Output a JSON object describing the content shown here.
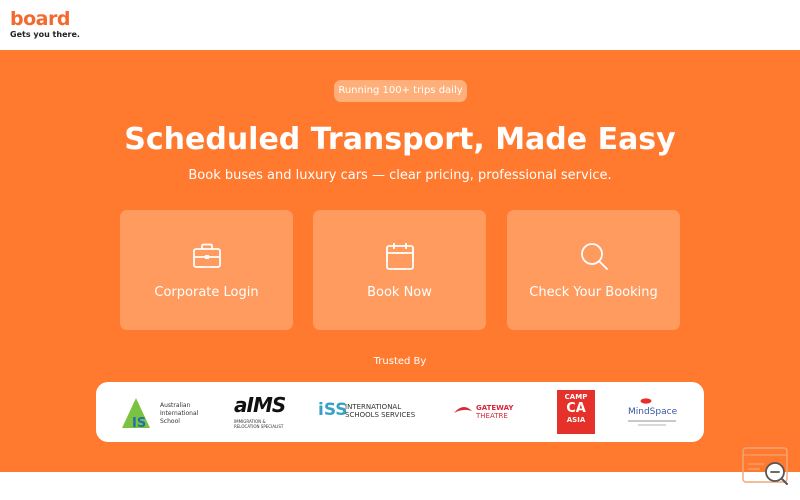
{
  "header": {
    "logo_word": "board",
    "logo_tagline": "Gets you there."
  },
  "hero": {
    "badge": "Running 100+ trips daily",
    "title": "Scheduled Transport, Made Easy",
    "subtitle": "Book buses and luxury cars — clear pricing, professional service.",
    "actions": [
      {
        "label": "Corporate Login",
        "icon": "briefcase-icon"
      },
      {
        "label": "Book Now",
        "icon": "calendar-icon"
      },
      {
        "label": "Check Your Booking",
        "icon": "search-icon"
      }
    ]
  },
  "trusted": {
    "heading": "Trusted By",
    "logos": [
      {
        "name": "Australian International School",
        "lines": [
          "Australian",
          "International",
          "School"
        ],
        "mark": "IS"
      },
      {
        "name": "AIMS Immigration & Relocation Specialist",
        "word": "aIMS",
        "sub": "IMMIGRATION &",
        "sub2": "RELOCATION SPECIALIST"
      },
      {
        "name": "International Schools Services",
        "mark": "iSS",
        "line1": "INTERNATIONAL",
        "line2": "SCHOOLS SERVICES"
      },
      {
        "name": "Gateway Theatre",
        "line1": "GATEWAY",
        "line2": "THEATRE"
      },
      {
        "name": "Camp CA Asia",
        "top": "CAMP",
        "mid": "CA",
        "bot": "ASIA"
      },
      {
        "name": "MindSpace",
        "word": "MindSpace"
      }
    ]
  },
  "colors": {
    "brand_orange": "#ff7a2f",
    "card_orange": "#ff9b5e",
    "badge_orange": "#ffb07a",
    "logo_orange": "#f26a2e"
  }
}
